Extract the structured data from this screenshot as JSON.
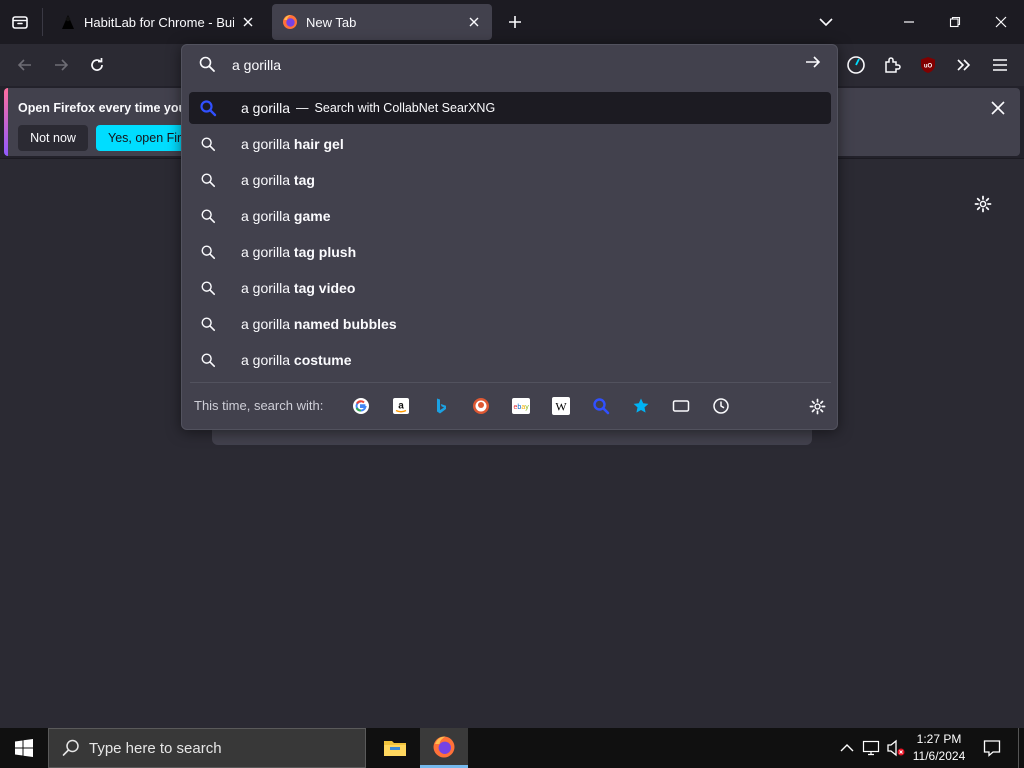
{
  "tabs": [
    {
      "title": "HabitLab for Chrome - Build better habits"
    },
    {
      "title": "New Tab"
    }
  ],
  "notification": {
    "text": "Open Firefox every time you",
    "not_now_label": "Not now",
    "yes_label": "Yes, open Firefox"
  },
  "urlbar": {
    "value": "a gorilla",
    "results": [
      {
        "prefix": "a gorilla",
        "suffix": "",
        "dash": "—",
        "action": "Search with CollabNet SearXNG",
        "selected": true
      },
      {
        "prefix": "a gorilla ",
        "suffix": "hair gel"
      },
      {
        "prefix": "a gorilla ",
        "suffix": "tag"
      },
      {
        "prefix": "a gorilla ",
        "suffix": "game"
      },
      {
        "prefix": "a gorilla ",
        "suffix": "tag plush"
      },
      {
        "prefix": "a gorilla ",
        "suffix": "tag video"
      },
      {
        "prefix": "a gorilla ",
        "suffix": "named bubbles"
      },
      {
        "prefix": "a gorilla ",
        "suffix": "costume"
      }
    ],
    "oneoff_label": "This time, search with:",
    "engines": [
      "google-icon",
      "amazon-icon",
      "bing-icon",
      "duckduckgo-icon",
      "ebay-icon",
      "wikipedia-icon",
      "searxng-icon",
      "bookmarks-icon",
      "tabs-icon",
      "history-icon"
    ]
  },
  "taskbar": {
    "search_placeholder": "Type here to search",
    "time": "1:27 PM",
    "date": "11/6/2024"
  },
  "colors": {
    "accent": "#00ddff",
    "selected_row": "#1c1b22",
    "popup_bg": "#42414d"
  }
}
